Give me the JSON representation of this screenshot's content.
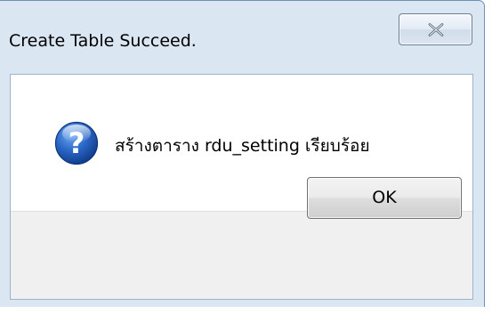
{
  "window": {
    "title": "Create Table Succeed.",
    "close_icon": "close-icon"
  },
  "message": {
    "icon": "question-icon",
    "text": "สร้างตาราง rdu_setting เรียบร้อย"
  },
  "buttons": {
    "ok_label": "OK"
  },
  "colors": {
    "frame": "#dbe6f3",
    "content_bg": "#ffffff",
    "button_area_bg": "#f0f0f0",
    "icon_blue": "#1d56b4"
  }
}
